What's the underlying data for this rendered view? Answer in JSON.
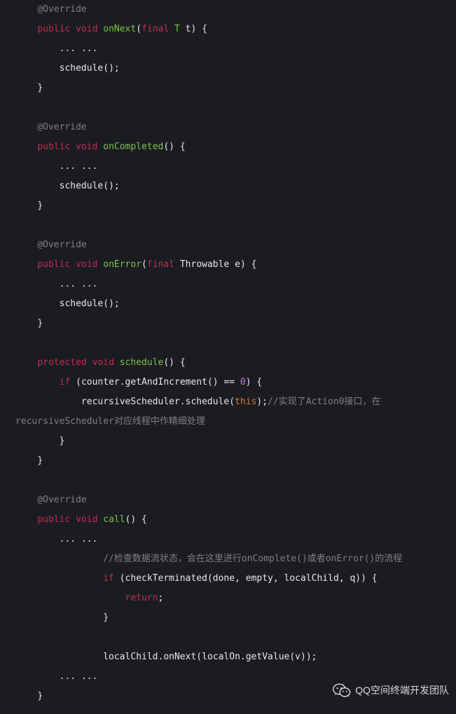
{
  "code": {
    "override": "@Override",
    "public": "public",
    "void": "void",
    "final": "final",
    "protected": "protected",
    "if": "if",
    "return": "return",
    "onNext": "onNext",
    "onCompleted": "onCompleted",
    "onError": "onError",
    "schedule": "schedule",
    "call": "call",
    "Throwable": "Throwable",
    "T": "T",
    "t": "t",
    "e": "e",
    "counter_getAndIncrement": "counter.getAndIncrement()",
    "eqeq": "==",
    "zero": "0",
    "rsched_prefix": "recursiveScheduler.schedule(",
    "this": "this",
    "rsched_suffix": ");",
    "comment1": "//实现了Action0接口，在recursiveScheduler对应线程中作精细处理",
    "comment2": "//检查数据流状态，会在这里进行onComplete()或者onError()的流程",
    "checkTerm_call": "(checkTerminated(done, empty, localChild, q)) {",
    "localChild_onNext": "localChild.onNext(localOn.getValue(v));",
    "schedule_call": "schedule();",
    "dots": "... ..."
  },
  "watermark": {
    "text": "QQ空间终端开发团队"
  }
}
